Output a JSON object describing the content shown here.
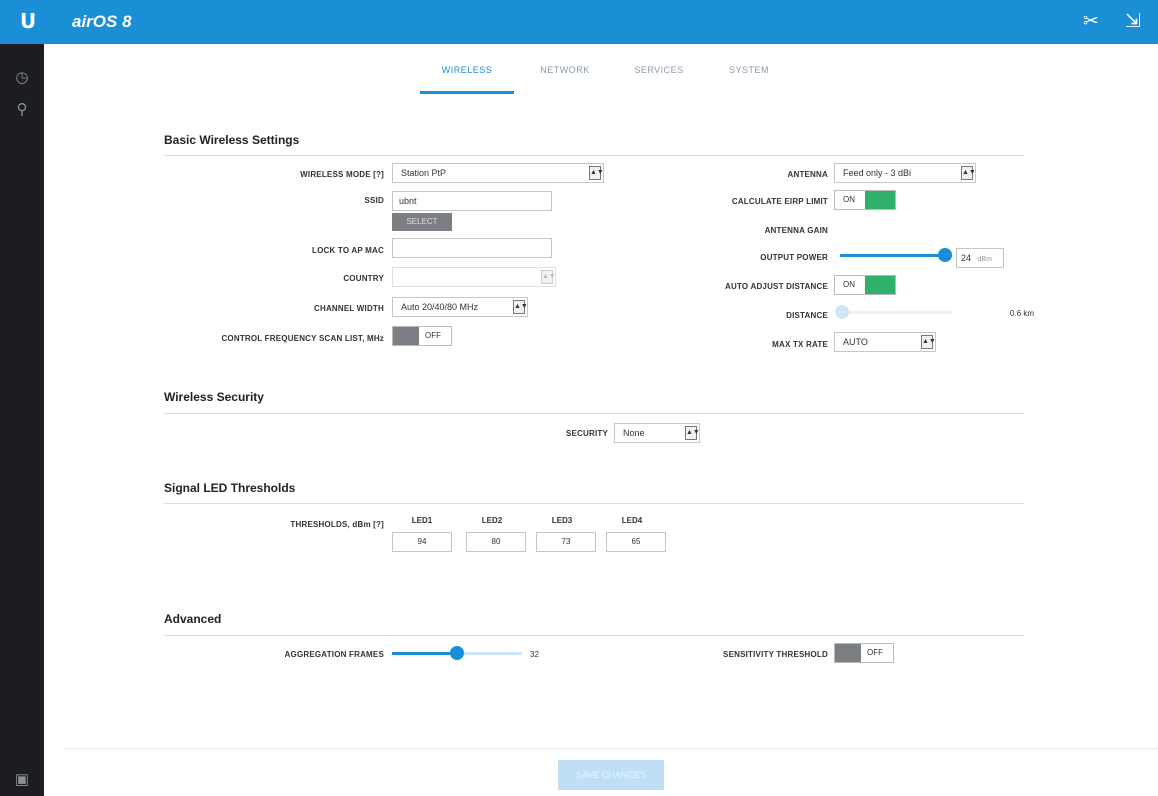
{
  "header": {
    "logo": "U",
    "product": "airOS 8",
    "device_name": "",
    "tools_icon": "tools-icon",
    "logout_icon": "logout-icon"
  },
  "sidebar": {
    "items": [
      {
        "icon": "dashboard-icon"
      },
      {
        "icon": "search-key-icon"
      },
      {
        "icon": "terminal-icon"
      }
    ]
  },
  "tabs": [
    {
      "label": "WIRELESS",
      "active": true
    },
    {
      "label": "NETWORK",
      "active": false
    },
    {
      "label": "SERVICES",
      "active": false
    },
    {
      "label": "SYSTEM",
      "active": false
    }
  ],
  "basic": {
    "title": "Basic Wireless Settings",
    "wireless_mode_label": "WIRELESS MODE [?]",
    "wireless_mode_value": "Station PtP",
    "ssid_label": "SSID",
    "ssid_value": "ubnt",
    "select_button": "SELECT",
    "lock_label": "LOCK TO AP MAC",
    "lock_value": "",
    "country_label": "COUNTRY",
    "country_value": "",
    "channel_width_label": "CHANNEL WIDTH",
    "channel_width_value": "Auto 20/40/80 MHz",
    "control_freq_label": "CONTROL FREQUENCY SCAN LIST, MHz",
    "control_freq_state": "OFF",
    "antenna_label": "ANTENNA",
    "antenna_value": "Feed only - 3 dBi",
    "calc_eirp_label": "CALCULATE EIRP LIMIT",
    "calc_eirp_state": "ON",
    "antenna_gain_label": "ANTENNA GAIN",
    "antenna_gain_value": "",
    "output_power_label": "OUTPUT POWER",
    "output_power_value": "24",
    "output_power_unit": "dBm",
    "auto_adjust_label": "AUTO ADJUST DISTANCE",
    "auto_adjust_state": "ON",
    "distance_label": "DISTANCE",
    "distance_value": "0.6 km",
    "max_tx_label": "MAX TX RATE",
    "max_tx_value": "AUTO"
  },
  "security": {
    "title": "Wireless Security",
    "label": "SECURITY",
    "value": "None"
  },
  "thresholds": {
    "title": "Signal LED Thresholds",
    "label": "THRESHOLDS, dBm [?]",
    "leds": [
      {
        "name": "LED1",
        "value": "94"
      },
      {
        "name": "LED2",
        "value": "80"
      },
      {
        "name": "LED3",
        "value": "73"
      },
      {
        "name": "LED4",
        "value": "65"
      }
    ]
  },
  "advanced": {
    "title": "Advanced",
    "aggregation_label": "AGGREGATION FRAMES",
    "aggregation_value": "32",
    "sensitivity_label": "SENSITIVITY THRESHOLD",
    "sensitivity_state": "OFF"
  },
  "footer": {
    "save_label": "SAVE CHANGES"
  },
  "colors": {
    "accent": "#1a8fd6",
    "toggle_on": "#2fb06b",
    "sidebar": "#1b1d20"
  },
  "sliders": {
    "output_power_fraction": 0.95,
    "distance_fraction": 0.0,
    "aggregation_fraction": 0.5
  }
}
